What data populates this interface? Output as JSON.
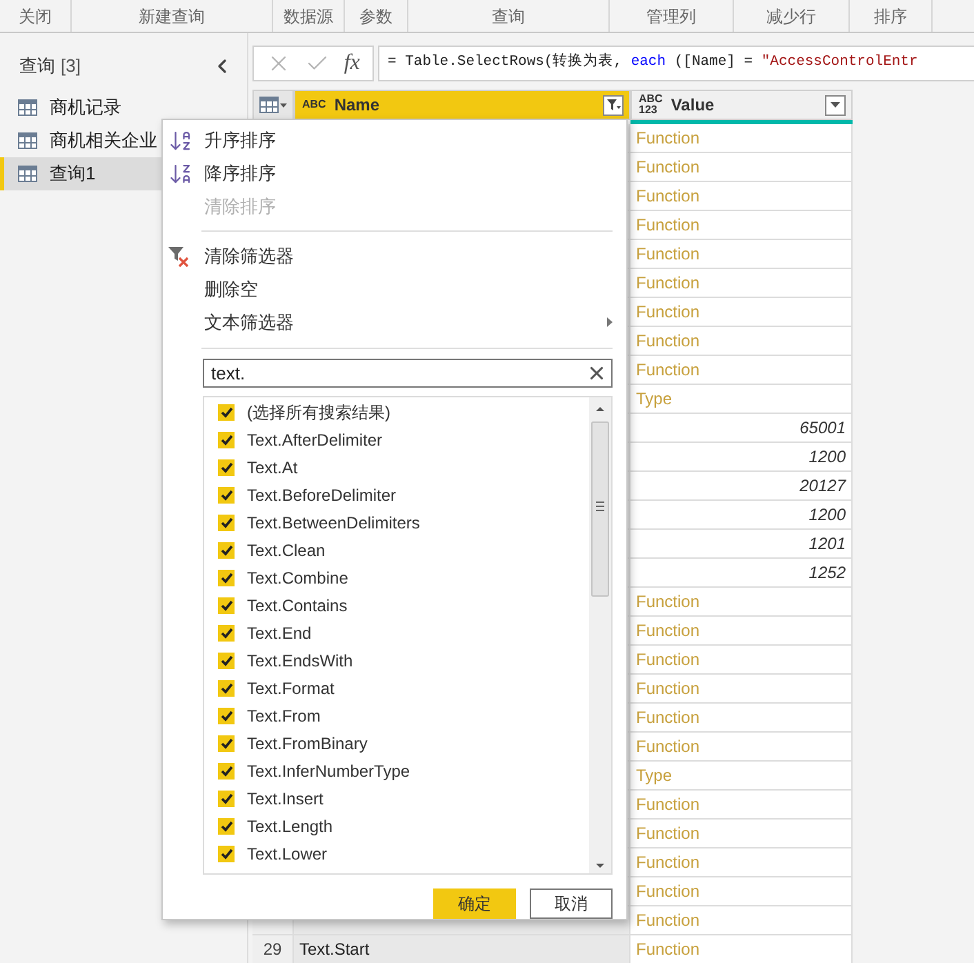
{
  "ribbon": {
    "groups": [
      "关闭",
      "新建查询",
      "数据源",
      "参数",
      "查询",
      "管理列",
      "减少行",
      "排序"
    ]
  },
  "queries_pane": {
    "title": "查询",
    "count": "[3]",
    "items": [
      {
        "label": "商机记录",
        "selected": false
      },
      {
        "label": "商机相关企业",
        "selected": false
      },
      {
        "label": "查询1",
        "selected": true
      }
    ]
  },
  "formula_bar": {
    "fx_label": "fx",
    "formula": [
      {
        "kind": "plain",
        "text": "= Table.SelectRows(转换为表, "
      },
      {
        "kind": "keyword",
        "text": "each"
      },
      {
        "kind": "plain",
        "text": " ([Name] = "
      },
      {
        "kind": "string",
        "text": "\"AccessControlEntr"
      }
    ]
  },
  "table": {
    "columns": [
      {
        "label": "Name",
        "type_icon": [
          "ABC"
        ],
        "filtered": true,
        "selected": true
      },
      {
        "label": "Value",
        "type_icon": [
          "ABC",
          "123"
        ],
        "filtered": false,
        "selected": false
      }
    ],
    "rows": [
      {
        "value": "Function",
        "kind": "type"
      },
      {
        "value": "Function",
        "kind": "type"
      },
      {
        "value": "Function",
        "kind": "type"
      },
      {
        "value": "Function",
        "kind": "type"
      },
      {
        "value": "Function",
        "kind": "type"
      },
      {
        "value": "Function",
        "kind": "type"
      },
      {
        "value": "Function",
        "kind": "type"
      },
      {
        "value": "Function",
        "kind": "type"
      },
      {
        "value": "Function",
        "kind": "type"
      },
      {
        "value": "Type",
        "kind": "type"
      },
      {
        "value": "65001",
        "kind": "number"
      },
      {
        "value": "1200",
        "kind": "number"
      },
      {
        "value": "20127",
        "kind": "number"
      },
      {
        "value": "1200",
        "kind": "number"
      },
      {
        "value": "1201",
        "kind": "number"
      },
      {
        "value": "1252",
        "kind": "number"
      },
      {
        "value": "Function",
        "kind": "type"
      },
      {
        "value": "Function",
        "kind": "type"
      },
      {
        "value": "Function",
        "kind": "type"
      },
      {
        "value": "Function",
        "kind": "type"
      },
      {
        "value": "Function",
        "kind": "type"
      },
      {
        "value": "Function",
        "kind": "type"
      },
      {
        "value": "Type",
        "kind": "type"
      },
      {
        "value": "Function",
        "kind": "type"
      },
      {
        "value": "Function",
        "kind": "type"
      },
      {
        "value": "Function",
        "kind": "type"
      },
      {
        "value": "Function",
        "kind": "type"
      },
      {
        "value": "Function",
        "kind": "type"
      },
      {
        "index": "29",
        "name": "Text.Start",
        "value": "Function",
        "kind": "type"
      }
    ]
  },
  "filter_menu": {
    "items": [
      {
        "label": "升序排序",
        "kind": "sort_asc",
        "disabled": false
      },
      {
        "label": "降序排序",
        "kind": "sort_desc",
        "disabled": false
      },
      {
        "label": "清除排序",
        "kind": "plain",
        "disabled": true
      },
      {
        "kind": "separator"
      },
      {
        "label": "清除筛选器",
        "kind": "clear_filter",
        "disabled": false
      },
      {
        "label": "删除空",
        "kind": "plain",
        "disabled": false
      },
      {
        "label": "文本筛选器",
        "kind": "submenu",
        "disabled": false
      },
      {
        "kind": "separator"
      }
    ],
    "search": {
      "value": "text."
    },
    "values": [
      {
        "label": "(选择所有搜索结果)",
        "checked": true
      },
      {
        "label": "Text.AfterDelimiter",
        "checked": true
      },
      {
        "label": "Text.At",
        "checked": true
      },
      {
        "label": "Text.BeforeDelimiter",
        "checked": true
      },
      {
        "label": "Text.BetweenDelimiters",
        "checked": true
      },
      {
        "label": "Text.Clean",
        "checked": true
      },
      {
        "label": "Text.Combine",
        "checked": true
      },
      {
        "label": "Text.Contains",
        "checked": true
      },
      {
        "label": "Text.End",
        "checked": true
      },
      {
        "label": "Text.EndsWith",
        "checked": true
      },
      {
        "label": "Text.Format",
        "checked": true
      },
      {
        "label": "Text.From",
        "checked": true
      },
      {
        "label": "Text.FromBinary",
        "checked": true
      },
      {
        "label": "Text.InferNumberType",
        "checked": true
      },
      {
        "label": "Text.Insert",
        "checked": true
      },
      {
        "label": "Text.Length",
        "checked": true
      },
      {
        "label": "Text.Lower",
        "checked": true
      }
    ],
    "buttons": {
      "ok": "确定",
      "cancel": "取消"
    }
  }
}
